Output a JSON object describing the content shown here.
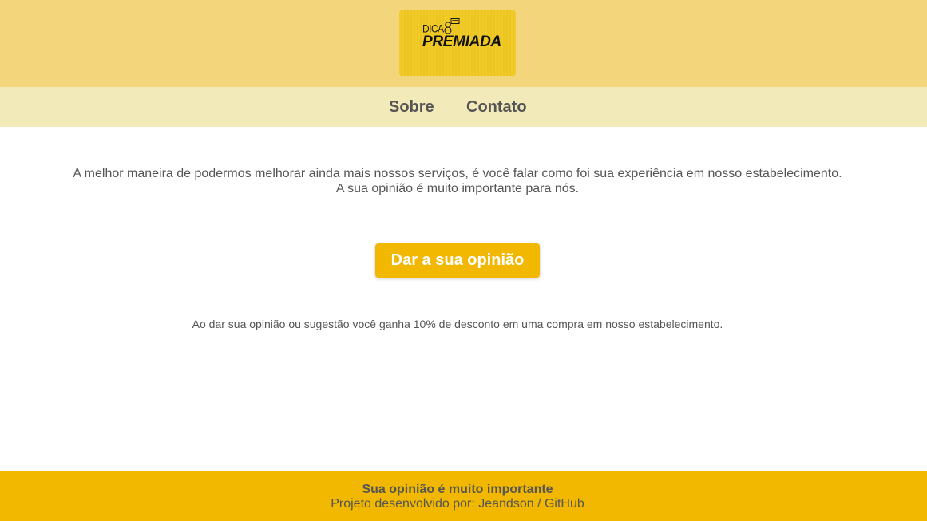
{
  "header": {
    "logo": {
      "small_text": "DICA",
      "big_text": "PREMIADA",
      "icon": "chat-bubbles-icon"
    }
  },
  "nav": {
    "items": [
      {
        "label": "Sobre"
      },
      {
        "label": "Contato"
      }
    ]
  },
  "main": {
    "intro_line1": "A melhor maneira de podermos melhorar ainda mais nossos serviços, é você falar como foi sua experiência em nosso estabelecimento.",
    "intro_line2": "A sua opinião é muito importante para nós.",
    "cta_label": "Dar a sua opinião",
    "discount_text": "Ao dar sua opinião ou sugestão você ganha 10% de desconto em uma compra em nosso estabelecimento."
  },
  "footer": {
    "title": "Sua opinião é muito importante",
    "credit_prefix": "Projeto desenvolvido por:",
    "author_link": "Jeandson",
    "separator": "/",
    "github_link": "GitHub"
  },
  "colors": {
    "header_bg": "#f3d67b",
    "nav_bg": "#f3eab9",
    "accent": "#f2b800",
    "text": "#555555"
  }
}
